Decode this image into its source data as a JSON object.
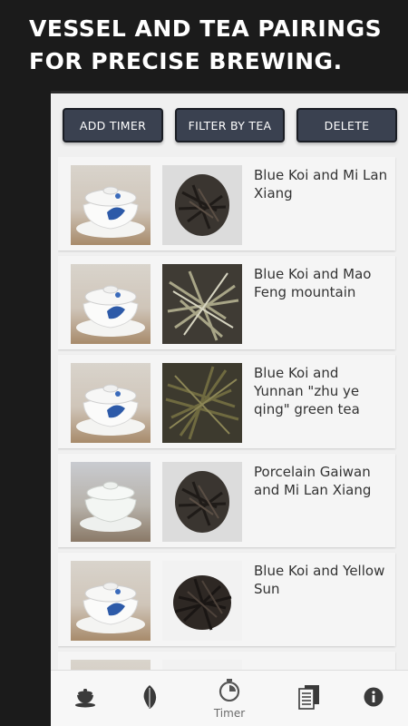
{
  "headline": {
    "line1": "VESSEL AND TEA PAIRINGS",
    "line2": "FOR PRECISE BREWING."
  },
  "toolbar": {
    "add_label": "ADD TIMER",
    "filter_label": "FILTER BY TEA",
    "delete_label": "DELETE"
  },
  "pairings": [
    {
      "label": "Blue Koi and Mi Lan Xiang",
      "vessel_icon": "gaiwan-blue-koi-photo",
      "tea_icon": "dark-twisted-leaves-photo"
    },
    {
      "label": "Blue Koi and Mao Feng mountain",
      "vessel_icon": "gaiwan-blue-koi-photo",
      "tea_icon": "green-silvery-leaves-photo"
    },
    {
      "label": "Blue Koi and Yunnan \"zhu ye qing\" green tea",
      "vessel_icon": "gaiwan-blue-koi-photo",
      "tea_icon": "green-needle-leaves-photo"
    },
    {
      "label": "Porcelain Gaiwan and Mi Lan Xiang",
      "vessel_icon": "porcelain-gaiwan-photo",
      "tea_icon": "dark-twisted-leaves-photo"
    },
    {
      "label": "Blue Koi and Yellow Sun",
      "vessel_icon": "gaiwan-blue-koi-photo",
      "tea_icon": "dark-curled-leaves-photo"
    }
  ],
  "bottom_nav": {
    "timer_label": "Timer",
    "items": [
      "teapot-icon",
      "leaf-icon",
      "stopwatch-icon",
      "documents-icon",
      "info-icon"
    ]
  },
  "colors": {
    "background": "#1b1b1b",
    "button": "#3a4150",
    "active_nav": "#555555"
  }
}
